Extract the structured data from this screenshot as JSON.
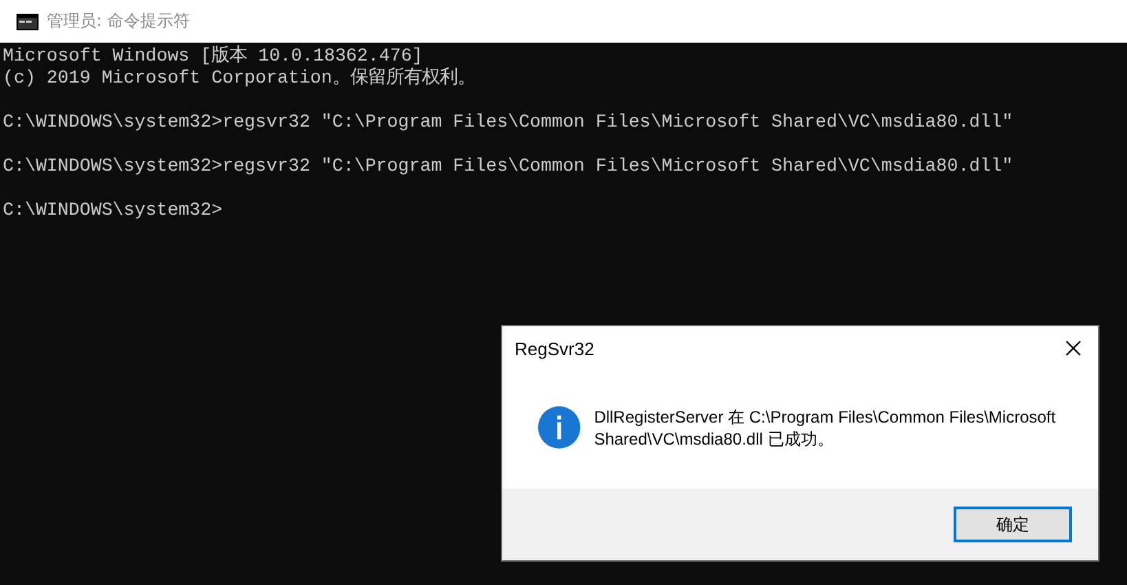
{
  "window": {
    "title": "管理员: 命令提示符"
  },
  "console": {
    "blocks": [
      [
        "Microsoft Windows [版本 10.0.18362.476]",
        "(c) 2019 Microsoft Corporation。保留所有权利。"
      ],
      [
        "C:\\WINDOWS\\system32>regsvr32 ″C:\\Program Files\\Common Files\\Microsoft Shared\\VC\\msdia80.dll″"
      ],
      [
        "C:\\WINDOWS\\system32>regsvr32 ″C:\\Program Files\\Common Files\\Microsoft Shared\\VC\\msdia80.dll″"
      ],
      [
        "C:\\WINDOWS\\system32>"
      ]
    ]
  },
  "dialog": {
    "title": "RegSvr32",
    "message": "DllRegisterServer 在 C:\\Program Files\\Common Files\\Microsoft Shared\\VC\\msdia80.dll 已成功。",
    "buttons": [
      {
        "label": "确定",
        "selected": true
      }
    ]
  }
}
